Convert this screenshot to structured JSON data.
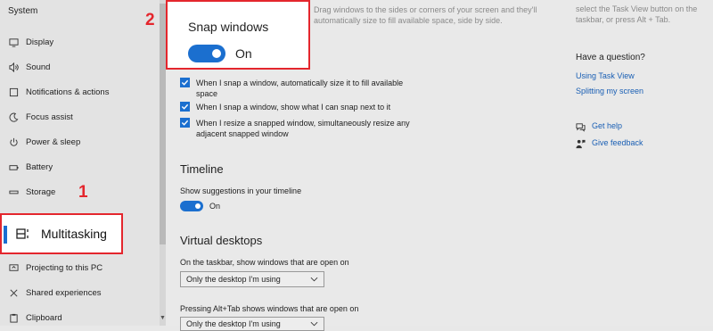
{
  "sidebar": {
    "title": "System",
    "items": [
      {
        "label": "Display",
        "icon": "display-icon"
      },
      {
        "label": "Sound",
        "icon": "sound-icon"
      },
      {
        "label": "Notifications & actions",
        "icon": "notifications-icon"
      },
      {
        "label": "Focus assist",
        "icon": "focus-assist-icon"
      },
      {
        "label": "Power & sleep",
        "icon": "power-icon"
      },
      {
        "label": "Battery",
        "icon": "battery-icon"
      },
      {
        "label": "Storage",
        "icon": "storage-icon"
      },
      {
        "label": "Multitasking",
        "icon": "multitasking-icon",
        "selected": true
      },
      {
        "label": "Projecting to this PC",
        "icon": "projecting-icon"
      },
      {
        "label": "Shared experiences",
        "icon": "shared-experiences-icon"
      },
      {
        "label": "Clipboard",
        "icon": "clipboard-icon"
      }
    ]
  },
  "annotations": {
    "one": "1",
    "two": "2",
    "color": "#e4262d"
  },
  "snap": {
    "partial_top_1": "Drag windows to the sides or corners of your screen and they'll",
    "partial_top_2": "automatically size to fill available space, side by side.",
    "title": "Snap windows",
    "state": "On",
    "options": [
      {
        "text": "When I snap a window, automatically size it to fill available space",
        "checked": true
      },
      {
        "text": "When I snap a window, show what I can snap next to it",
        "checked": true
      },
      {
        "text": "When I resize a snapped window, simultaneously resize any adjacent snapped window",
        "checked": true
      }
    ]
  },
  "timeline": {
    "heading": "Timeline",
    "label": "Show suggestions in your timeline",
    "state": "On"
  },
  "virtual_desktops": {
    "heading": "Virtual desktops",
    "taskbar_label": "On the taskbar, show windows that are open on",
    "taskbar_value": "Only the desktop I'm using",
    "alttab_label": "Pressing Alt+Tab shows windows that are open on",
    "alttab_value": "Only the desktop I'm using"
  },
  "right_panel": {
    "partial_1": "select the Task View button on the",
    "partial_2": "taskbar, or press Alt + Tab.",
    "question": "Have a question?",
    "links": [
      "Using Task View",
      "Splitting my screen"
    ],
    "get_help": "Get help",
    "give_feedback": "Give feedback"
  },
  "colors": {
    "accent": "#1b6fcf",
    "highlight": "#e4262d"
  }
}
